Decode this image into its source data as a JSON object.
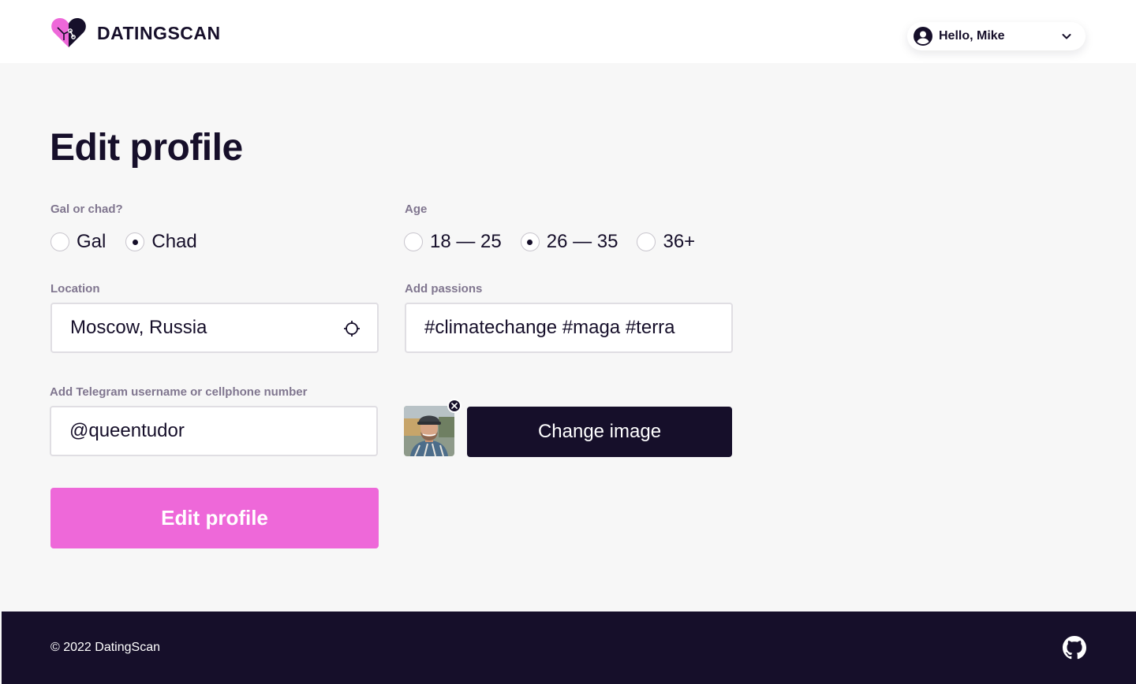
{
  "header": {
    "brand_name": "DATINGSCAN",
    "user_greeting": "Hello, Mike"
  },
  "main": {
    "title": "Edit profile",
    "gender": {
      "label": "Gal or chad?",
      "options": [
        "Gal",
        "Chad"
      ],
      "selected": "Chad"
    },
    "age": {
      "label": "Age",
      "options": [
        "18 — 25",
        "26 — 35",
        "36+"
      ],
      "selected": "26 — 35"
    },
    "location": {
      "label": "Location",
      "value": "Moscow, Russia"
    },
    "passions": {
      "label": "Add passions",
      "value": "#climatechange #maga #terra"
    },
    "contact": {
      "label": "Add Telegram username or cellphone number",
      "value": "@queentudor"
    },
    "image": {
      "change_label": "Change image"
    },
    "submit_label": "Edit profile"
  },
  "footer": {
    "copyright": "© 2022 DatingScan"
  },
  "colors": {
    "dark": "#160f2a",
    "accent_pink": "#ee68d9",
    "background": "#f7f7f7",
    "label_gray": "#80768f"
  }
}
